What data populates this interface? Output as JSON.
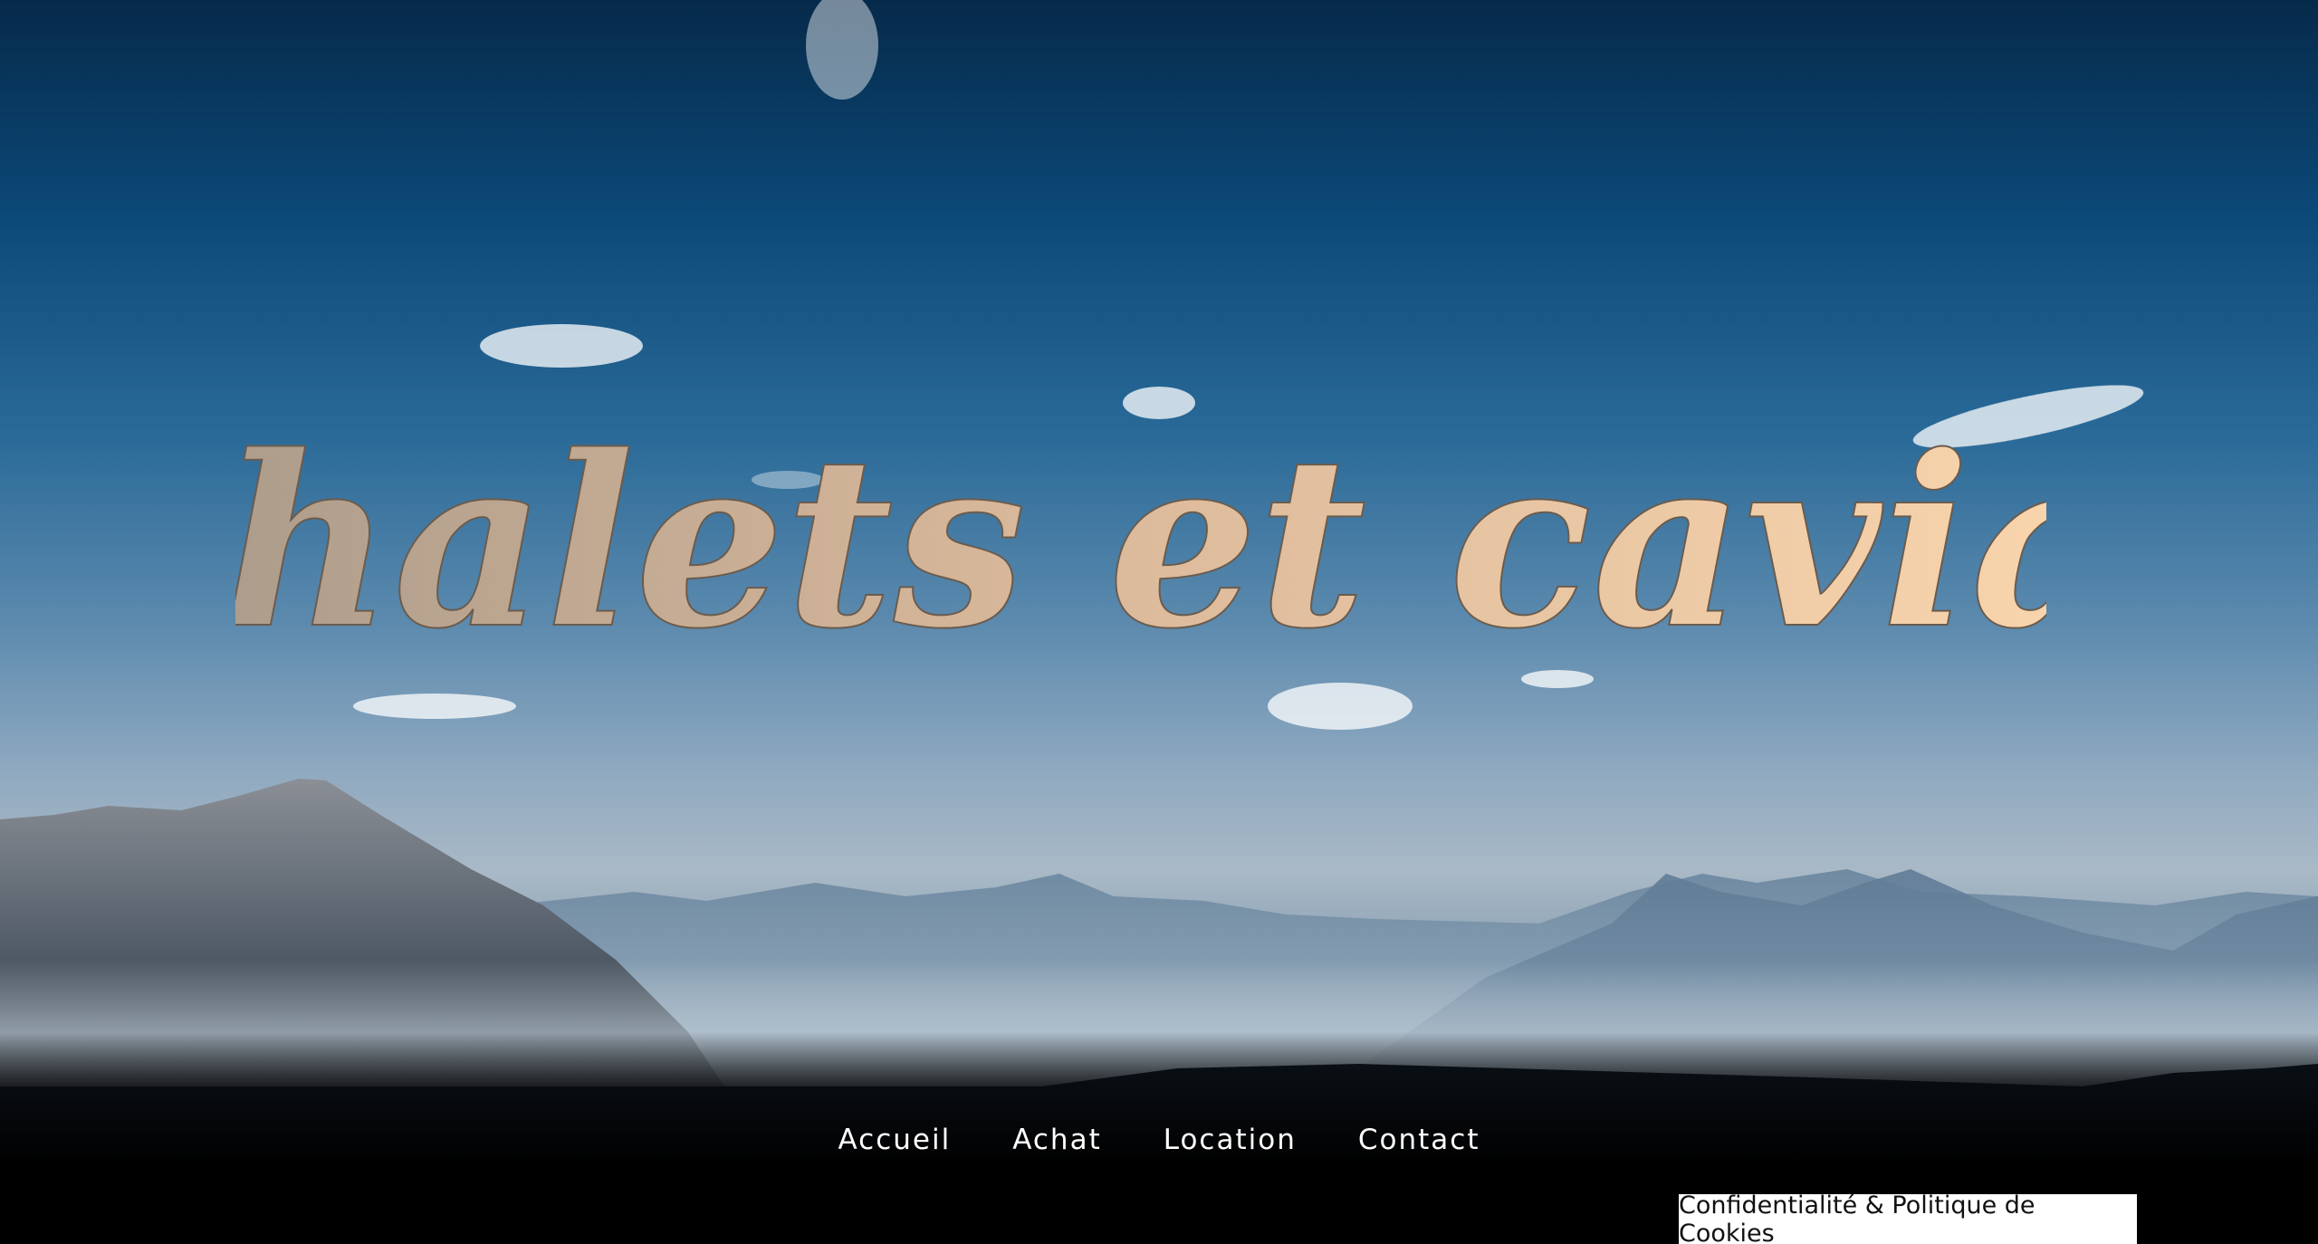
{
  "site": {
    "title": "Chalets et caviar"
  },
  "nav": {
    "items": [
      {
        "label": "Accueil"
      },
      {
        "label": "Achat"
      },
      {
        "label": "Location"
      },
      {
        "label": "Contact"
      }
    ]
  },
  "cookie": {
    "label": "Confidentialité & Politique de Cookies"
  },
  "colors": {
    "title_gradient_start": "#a89a8c",
    "title_gradient_end": "#ffd9b0",
    "sky_top": "#062a4a",
    "nav_text": "#ffffff",
    "cookie_bg": "#ffffff"
  }
}
